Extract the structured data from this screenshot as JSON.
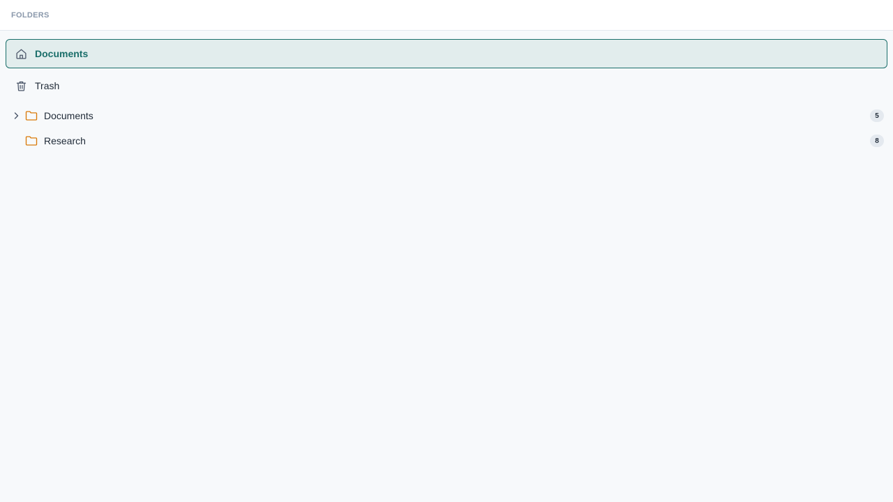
{
  "header": {
    "title": "FOLDERS"
  },
  "nav": {
    "items": [
      {
        "label": "Documents",
        "icon": "home-icon",
        "active": true
      },
      {
        "label": "Trash",
        "icon": "trash-icon",
        "active": false
      }
    ]
  },
  "tree": {
    "folders": [
      {
        "label": "Documents",
        "count": "5",
        "expandable": true,
        "icon": "folder-icon"
      },
      {
        "label": "Research",
        "count": "8",
        "expandable": false,
        "icon": "folder-icon"
      }
    ]
  },
  "colors": {
    "accent": "#1a6e6a",
    "active_bg": "#e2eded",
    "folder": "#d97a0a",
    "badge_bg": "#e4e9ef"
  }
}
